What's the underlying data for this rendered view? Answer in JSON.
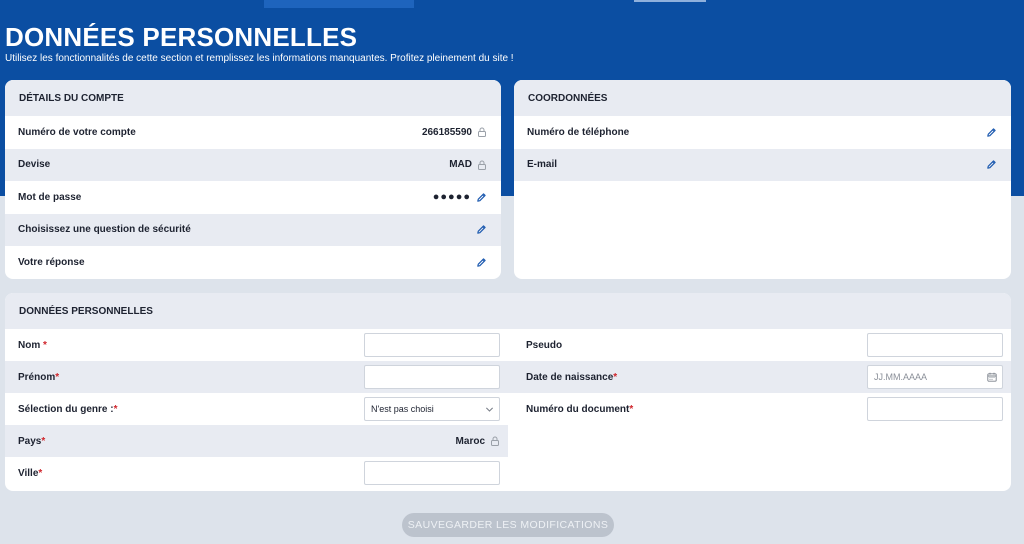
{
  "header": {
    "title": "DONNÉES PERSONNELLES",
    "subtitle": "Utilisez les fonctionnalités de cette section et remplissez les informations manquantes. Profitez pleinement du site !"
  },
  "account": {
    "title": "DÉTAILS DU COMPTE",
    "rows": [
      {
        "label": "Numéro de votre compte",
        "value": "266185590",
        "icon": "lock-icon"
      },
      {
        "label": "Devise",
        "value": "MAD",
        "icon": "lock-icon"
      },
      {
        "label": "Mot de passe",
        "value": "●●●●●",
        "icon": "pencil-icon"
      },
      {
        "label": "Choisissez une question de sécurité",
        "value": "",
        "icon": "pencil-icon"
      },
      {
        "label": "Votre réponse",
        "value": "",
        "icon": "pencil-icon"
      }
    ]
  },
  "contact": {
    "title": "COORDONNÉES",
    "rows": [
      {
        "label": "Numéro de téléphone",
        "icon": "pencil-icon"
      },
      {
        "label": "E-mail",
        "icon": "pencil-icon"
      }
    ]
  },
  "personal": {
    "title": "DONNÉES PERSONNELLES",
    "nom": {
      "label": "Nom ",
      "required": "*",
      "value": ""
    },
    "prenom": {
      "label": "Prénom",
      "required": "*",
      "value": ""
    },
    "genre": {
      "label": "Sélection du genre :",
      "required": "*",
      "selected": "N'est pas choisi"
    },
    "pays": {
      "label": "Pays",
      "required": "*",
      "value": "Maroc"
    },
    "ville": {
      "label": "Ville",
      "required": "*",
      "value": ""
    },
    "pseudo": {
      "label": "Pseudo",
      "value": ""
    },
    "naissance": {
      "label": "Date de naissance",
      "required": "*",
      "placeholder": "JJ.MM.AAAA"
    },
    "document": {
      "label": "Numéro du document",
      "required": "*",
      "value": ""
    }
  },
  "save_label": "SAUVEGARDER LES MODIFICATIONS",
  "colors": {
    "header_bg": "#0b4ea2",
    "row_alt": "#e8ebf2",
    "icon": "#1e5bb0",
    "required": "#d0262c"
  }
}
